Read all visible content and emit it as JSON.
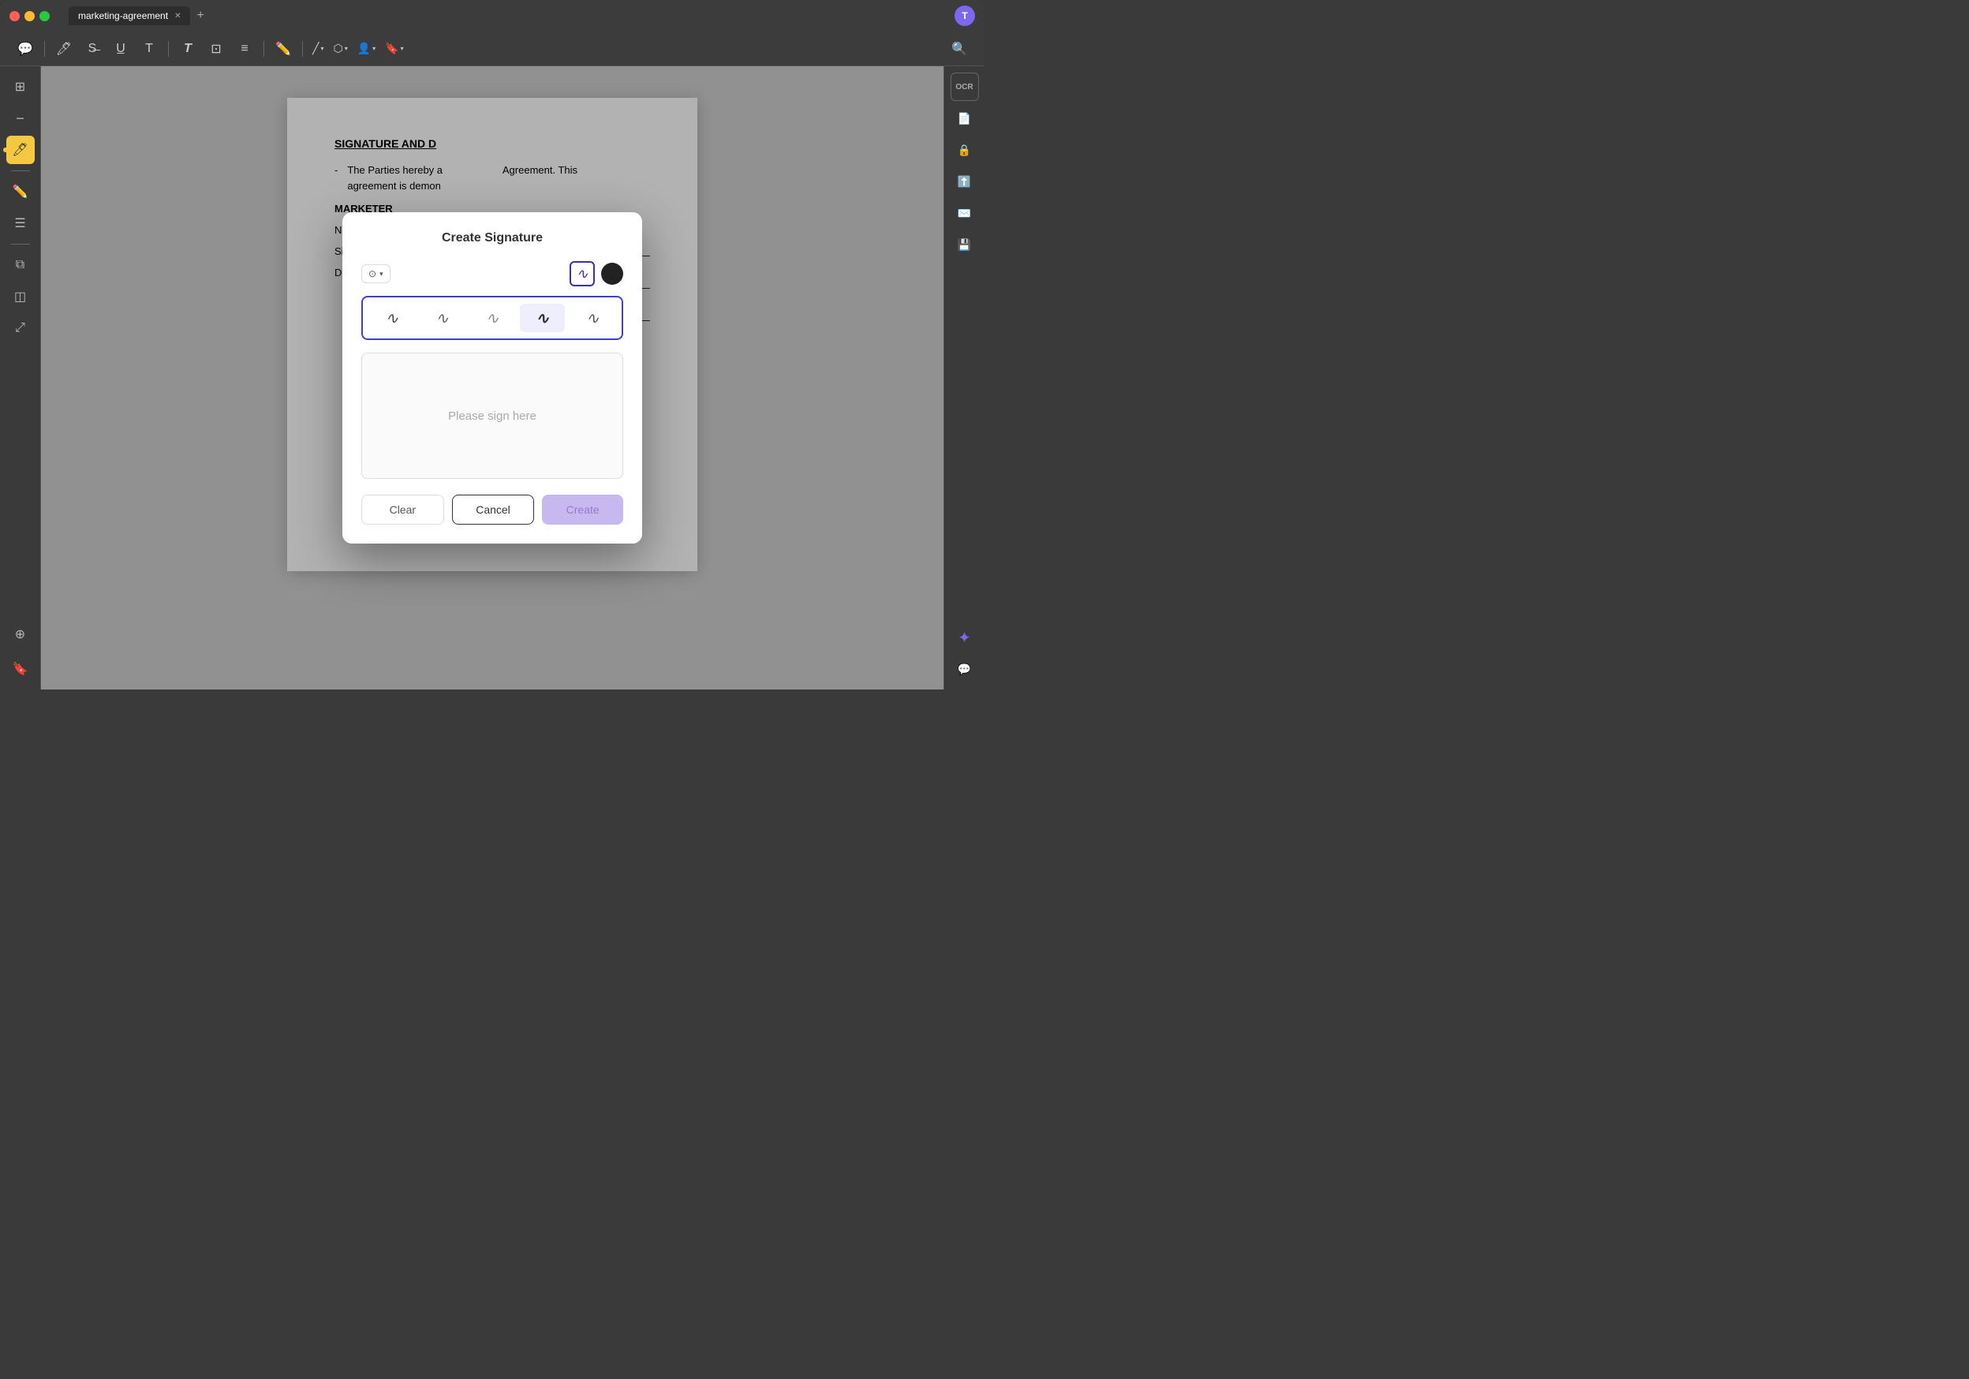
{
  "window": {
    "title": "marketing-agreement"
  },
  "titlebar": {
    "tab_label": "marketing-agreement",
    "avatar_letter": "T"
  },
  "toolbar": {
    "icons": [
      "comment",
      "highlight",
      "strikethrough",
      "underline",
      "text",
      "text-box",
      "text-align",
      "draw",
      "shape",
      "line",
      "mask",
      "person",
      "stamp"
    ],
    "search_icon": "search"
  },
  "left_sidebar": {
    "icons": [
      "sidebar-layout",
      "minus",
      "highlight-pen",
      "document-edit",
      "list",
      "layers",
      "stamp-icon",
      "move",
      "bottom1",
      "bottom2"
    ]
  },
  "document": {
    "section_heading": "SIGNATURE AND D",
    "bullet_text": "The Parties hereby a",
    "bullet_suffix": "Agreement. This",
    "bullet_line2": "agreement is demon",
    "marketer_label": "MARKETER",
    "name_label": "Name:",
    "signature_label": "Signature:",
    "date_label": "Date:"
  },
  "modal": {
    "title": "Create Signature",
    "sign_placeholder": "Please sign here",
    "signature_styles": [
      "~",
      "~",
      "~",
      "~",
      "~"
    ],
    "buttons": {
      "clear": "Clear",
      "cancel": "Cancel",
      "create": "Create"
    }
  },
  "right_sidebar": {
    "icons": [
      "ocr",
      "document-search",
      "lock",
      "save",
      "email",
      "floppy",
      "sparkle",
      "chat"
    ]
  }
}
